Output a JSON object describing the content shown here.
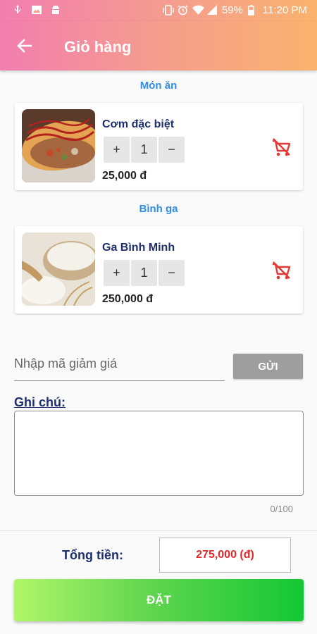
{
  "status_bar": {
    "battery": "59%",
    "time": "11:20 PM",
    "icons_left": [
      "usb-icon",
      "image-icon",
      "android-icon"
    ],
    "icons_right": [
      "vibrate-icon",
      "alarm-icon",
      "wifi-icon",
      "signal-icon",
      "battery-icon"
    ]
  },
  "app_bar": {
    "title": "Giỏ hàng",
    "back_icon": "arrow-left-icon"
  },
  "sections": [
    {
      "title": "Món ăn",
      "item": {
        "name": "Cơm đặc biệt",
        "quantity": "1",
        "price": "25,000 đ",
        "plus": "+",
        "minus": "−"
      }
    },
    {
      "title": "Bình ga",
      "item": {
        "name": "Ga Bình Minh",
        "quantity": "1",
        "price": "250,000 đ",
        "plus": "+",
        "minus": "−"
      }
    }
  ],
  "coupon": {
    "placeholder": "Nhập mã giảm giá",
    "value": "",
    "button_label": "GỬI"
  },
  "note": {
    "label": "Ghi chú:",
    "value": "",
    "counter": "0/100"
  },
  "footer": {
    "total_label": "Tổng tiền:",
    "total_value": "275,000 (đ)",
    "order_label": "ĐẶT"
  },
  "colors": {
    "header_gradient_start": "#f27eb0",
    "header_gradient_end": "#f9b36d",
    "section_title": "#2f8de4",
    "text_navy": "#1d2f6f",
    "remove_red": "#e53935",
    "total_red": "#e0282e",
    "order_gradient_start": "#b1f56a",
    "order_gradient_end": "#13c734"
  }
}
